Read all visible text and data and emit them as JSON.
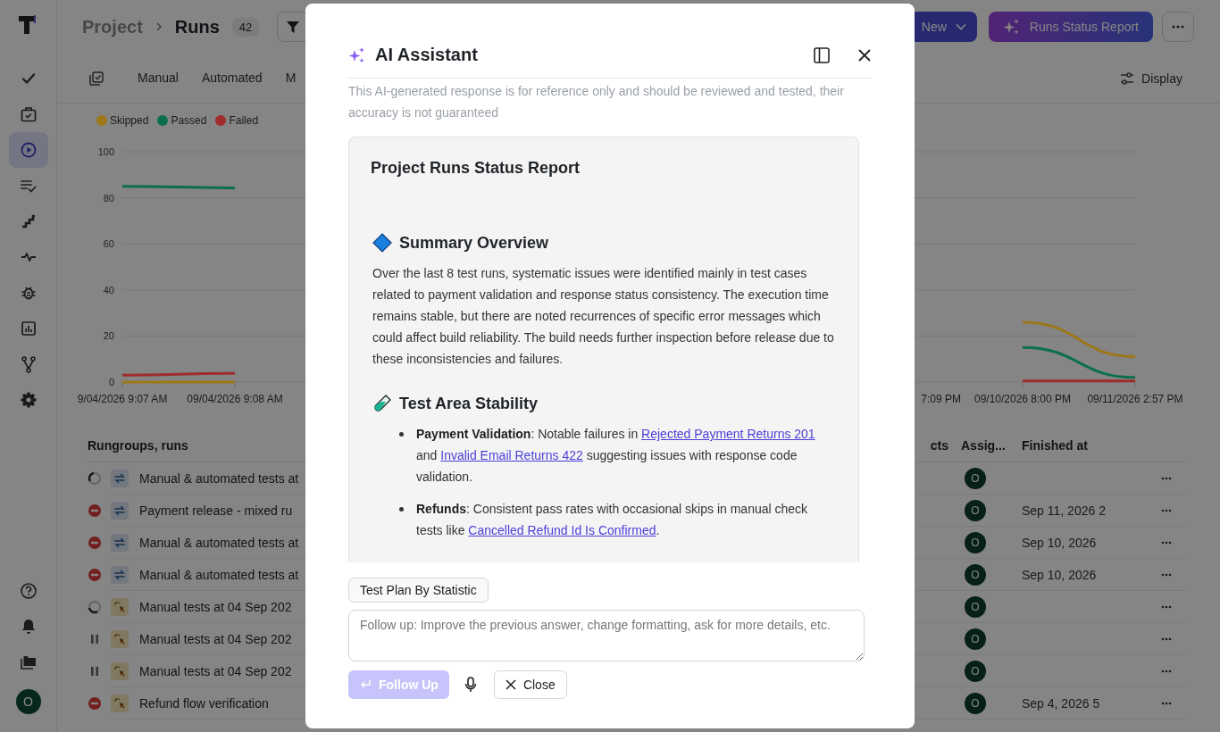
{
  "sidebar": {
    "nav": [
      {
        "kind": "check",
        "selected": false
      },
      {
        "kind": "briefcase",
        "selected": false
      },
      {
        "kind": "play",
        "selected": true
      },
      {
        "kind": "list",
        "selected": false
      },
      {
        "kind": "stairs",
        "selected": false
      },
      {
        "kind": "pulse",
        "selected": false
      },
      {
        "kind": "bug",
        "selected": false
      },
      {
        "kind": "chart",
        "selected": false
      },
      {
        "kind": "branch",
        "selected": false
      },
      {
        "kind": "gear",
        "selected": false
      }
    ],
    "bottom": [
      {
        "kind": "help"
      },
      {
        "kind": "bell"
      },
      {
        "kind": "folders"
      }
    ],
    "avatar": "O"
  },
  "header": {
    "breadcrumb": "Project",
    "title": "Runs",
    "count": "42",
    "new_button": "New",
    "report_button": "Runs Status Report"
  },
  "tabs": [
    {
      "label": "Manual",
      "selected": false
    },
    {
      "label": "Automated",
      "selected": false
    },
    {
      "label": "M",
      "selected": false
    }
  ],
  "display_button": "Display",
  "chart": {
    "chart_data": {
      "type": "line",
      "grid": true,
      "categories": [
        "9/04/2026 9:07 AM",
        "09/04/2026 9:08 AM",
        null,
        null,
        null,
        null,
        null,
        "7:09 PM",
        "09/10/2026 8:00 PM",
        "09/11/2026 2:57 PM"
      ],
      "ylim": [
        0,
        100
      ],
      "yticks": [
        0,
        20,
        40,
        60,
        80,
        100
      ],
      "series": [
        {
          "name": "Skipped",
          "color": "#9c7818",
          "values": [
            0,
            0,
            null,
            null,
            null,
            null,
            null,
            null,
            26,
            11
          ]
        },
        {
          "name": "Passed",
          "color": "#0c6f4c",
          "values": [
            85,
            84.3,
            null,
            null,
            null,
            null,
            null,
            null,
            15,
            2
          ]
        },
        {
          "name": "Failed",
          "color": "#a02c2c",
          "values": [
            3,
            3.8,
            null,
            null,
            null,
            null,
            null,
            null,
            0.5,
            0.5
          ]
        }
      ]
    }
  },
  "table": {
    "columns": [
      "Rungroups, runs",
      "cts",
      "Assig...",
      "Finished at"
    ],
    "rows": [
      {
        "kind": "in_progress",
        "type_icon": {
          "kind": "mixed"
        },
        "name": "Manual & automated tests at",
        "assignee": "O"
      },
      {
        "kind": "blocked",
        "type_icon": {
          "kind": "mixed"
        },
        "name": "Payment release - mixed ru",
        "assignee": "O",
        "finished": "Sep 11, 2026 2"
      },
      {
        "kind": "blocked",
        "type_icon": {
          "kind": "mixed"
        },
        "name": "Manual & automated tests at",
        "assignee": "O",
        "finished": "Sep 10, 2026"
      },
      {
        "kind": "blocked",
        "type_icon": {
          "kind": "mixed"
        },
        "name": "Manual & automated tests at",
        "assignee": "O",
        "finished": "Sep 10, 2026"
      },
      {
        "kind": "in_progress",
        "type_icon": {
          "kind": "manual"
        },
        "name": "Manual tests at 04 Sep 202",
        "assignee": "O"
      },
      {
        "kind": "paused",
        "type_icon": {
          "kind": "manual"
        },
        "name": "Manual tests at 04 Sep 202",
        "assignee": "O"
      },
      {
        "kind": "paused",
        "type_icon": {
          "kind": "manual"
        },
        "name": "Manual tests at 04 Sep 202",
        "assignee": "O"
      },
      {
        "kind": "blocked",
        "type_icon": {
          "kind": "manual"
        },
        "name": "Refund flow verification",
        "assignee": "O",
        "finished": "Sep 4, 2026 5"
      }
    ]
  },
  "modal": {
    "title": "AI Assistant",
    "disclaimer": "This AI-generated response is for reference only and should be reviewed and tested, their accuracy is not guaranteed",
    "report": {
      "title": "Project Runs Status Report",
      "sections": [
        {
          "kind": "diamond",
          "heading": "Summary Overview",
          "paragraph": "Over the last 8 test runs, systematic issues were identified mainly in test cases related to payment validation and response status consistency. The execution time remains stable, but there are noted recurrences of specific error messages which could affect build reliability. The build needs further inspection before release due to these inconsistencies and failures."
        },
        {
          "kind": "test_tube",
          "heading": "Test Area Stability",
          "bullets": [
            [
              {
                "kind": "text",
                "text": "**Payment Validation**: Notable failures in "
              },
              {
                "kind": "link",
                "text": "Rejected Payment Returns 201"
              },
              {
                "kind": "text",
                "text": " and "
              },
              {
                "kind": "link",
                "text": "Invalid Email Returns 422"
              },
              {
                "kind": "text",
                "text": " suggesting issues with response code validation."
              }
            ],
            [
              {
                "kind": "text",
                "text": "**Refunds**: Consistent pass rates with occasional skips in manual check tests like "
              },
              {
                "kind": "link",
                "text": "Cancelled Refund Id Is Confirmed"
              },
              {
                "kind": "text",
                "text": "."
              }
            ]
          ]
        }
      ]
    },
    "suggestion": "Test Plan By Statistic",
    "input": {
      "placeholder": "Follow up: Improve the previous answer, change formatting, ask for more details, etc."
    },
    "follow_up": {
      "label": "Follow Up",
      "disabled": true
    },
    "close_button": "Close"
  }
}
